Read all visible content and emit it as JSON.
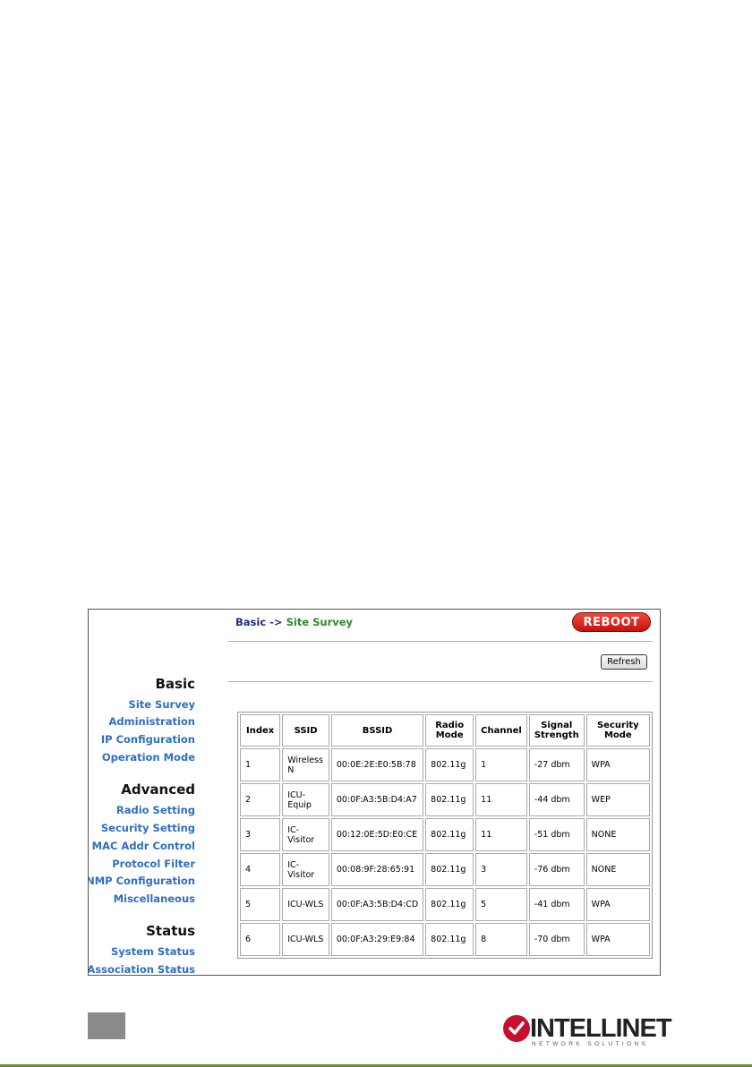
{
  "sidebar": {
    "sections": [
      {
        "title": "Basic",
        "items": [
          "Site Survey",
          "Administration",
          "IP Configuration",
          "Operation Mode"
        ]
      },
      {
        "title": "Advanced",
        "items": [
          "Radio Setting",
          "Security Setting",
          "MAC Addr Control",
          "Protocol Filter",
          "SNMP Configuration",
          "Miscellaneous"
        ]
      },
      {
        "title": "Status",
        "items": [
          "System Status",
          "Association Status"
        ]
      }
    ]
  },
  "header": {
    "breadcrumb_section": "Basic",
    "breadcrumb_arrow": "->",
    "breadcrumb_page": "Site Survey",
    "reboot_label": "REBOOT"
  },
  "toolbar": {
    "refresh_label": "Refresh"
  },
  "table": {
    "headers": [
      "Index",
      "SSID",
      "BSSID",
      "Radio Mode",
      "Channel",
      "Signal Strength",
      "Security Mode"
    ],
    "rows": [
      [
        "1",
        "Wireless N",
        "00:0E:2E:E0:5B:78",
        "802.11g",
        "1",
        "-27 dbm",
        "WPA"
      ],
      [
        "2",
        "ICU-Equip",
        "00:0F:A3:5B:D4:A7",
        "802.11g",
        "11",
        "-44 dbm",
        "WEP"
      ],
      [
        "3",
        "IC-Visitor",
        "00:12:0E:5D:E0:CE",
        "802.11g",
        "11",
        "-51 dbm",
        "NONE"
      ],
      [
        "4",
        "IC-Visitor",
        "00:08:9F:28:65:91",
        "802.11g",
        "3",
        "-76 dbm",
        "NONE"
      ],
      [
        "5",
        "ICU-WLS",
        "00:0F:A3:5B:D4:CD",
        "802.11g",
        "5",
        "-41 dbm",
        "WPA"
      ],
      [
        "6",
        "ICU-WLS",
        "00:0F:A3:29:E9:84",
        "802.11g",
        "8",
        "-70 dbm",
        "WPA"
      ]
    ]
  },
  "footer": {
    "brand": "INTELLINET",
    "tagline": "NETWORK SOLUTIONS"
  },
  "colors": {
    "link": "#2f6fc1",
    "crumb_section": "#1d2a8a",
    "crumb_page": "#2d8a2d",
    "reboot": "#d0201a"
  }
}
